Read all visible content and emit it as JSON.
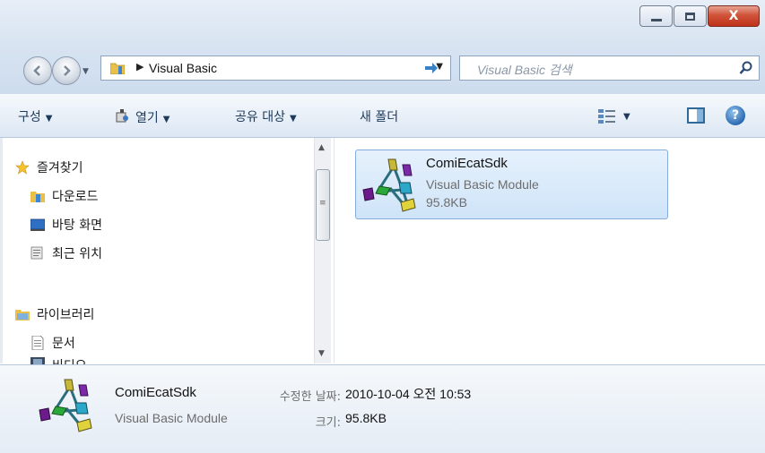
{
  "window": {
    "caption_buttons": {
      "close_label": "X"
    }
  },
  "navigation": {
    "address_crumb": "Visual Basic",
    "search_placeholder": "Visual Basic 검색"
  },
  "toolbar": {
    "organize": "구성",
    "open": "열기",
    "share_with": "공유 대상",
    "new_folder": "새 폴더"
  },
  "nav_pane": {
    "items": [
      {
        "label": "즐겨찾기",
        "icon": "star-icon"
      },
      {
        "label": "다운로드",
        "icon": "downloads-folder-icon"
      },
      {
        "label": "바탕 화면",
        "icon": "desktop-icon"
      },
      {
        "label": "최근 위치",
        "icon": "recent-places-icon"
      },
      {
        "label": "라이브러리",
        "icon": "libraries-icon"
      },
      {
        "label": "문서",
        "icon": "documents-icon"
      },
      {
        "label": "비디오",
        "icon": "videos-icon"
      }
    ]
  },
  "files": [
    {
      "name": "ComiEcatSdk",
      "type": "Visual Basic Module",
      "size": "95.8KB",
      "icon": "vb-module-icon",
      "selected": true
    }
  ],
  "details": {
    "name": "ComiEcatSdk",
    "type": "Visual Basic Module",
    "modified_label": "수정한 날짜:",
    "modified_value": "2010-10-04 오전 10:53",
    "size_label": "크기:",
    "size_value": "95.8KB"
  },
  "colors": {
    "chrome": "#d7e3f1",
    "selection": "#cfe4f8",
    "selection_border": "#84acdd",
    "close_button": "#c0311a",
    "toolbar_text": "#1e395b"
  }
}
